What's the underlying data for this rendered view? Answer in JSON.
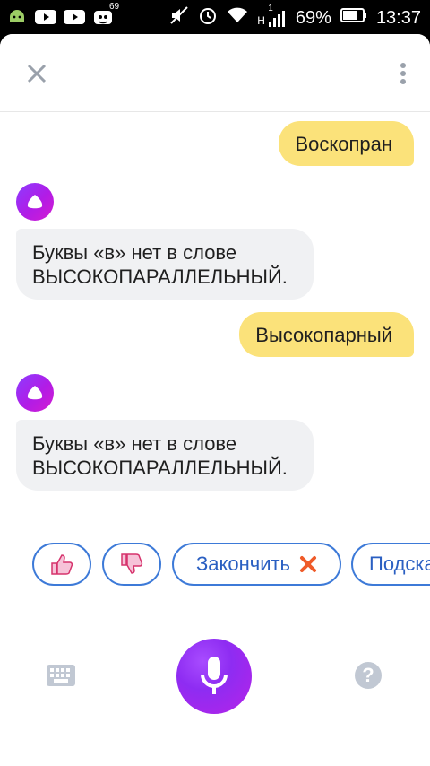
{
  "status_bar": {
    "notification_badge": "69",
    "network_type": "H",
    "signal_small": "1",
    "battery": "69%",
    "time": "13:37"
  },
  "messages": [
    {
      "role": "user",
      "text": "Воскопран"
    },
    {
      "role": "assistant",
      "line1": "Буквы «в» нет в слове",
      "line2": "ВЫСОКОПАРАЛЛЕЛЬНЫЙ."
    },
    {
      "role": "user",
      "text": "Высокопарный"
    },
    {
      "role": "assistant",
      "line1": "Буквы «в» нет в слове",
      "line2": "ВЫСОКОПАРАЛЛЕЛЬНЫЙ."
    }
  ],
  "suggestions": {
    "like_icon": "thumbs-up-icon",
    "dislike_icon": "thumbs-down-icon",
    "finish_label": "Закончить",
    "hint_label": "Подска"
  },
  "icons": {
    "close": "close-icon",
    "more": "more-vertical-icon",
    "keyboard": "keyboard-icon",
    "microphone": "microphone-icon",
    "help": "help-icon",
    "accent_gradient": [
      "#8c3cff",
      "#d41dd1"
    ],
    "user_bubble_color": "#fbe27a",
    "bot_bubble_color": "#f0f1f3",
    "chip_border_color": "#3d7ad8"
  },
  "help_glyph": "?"
}
